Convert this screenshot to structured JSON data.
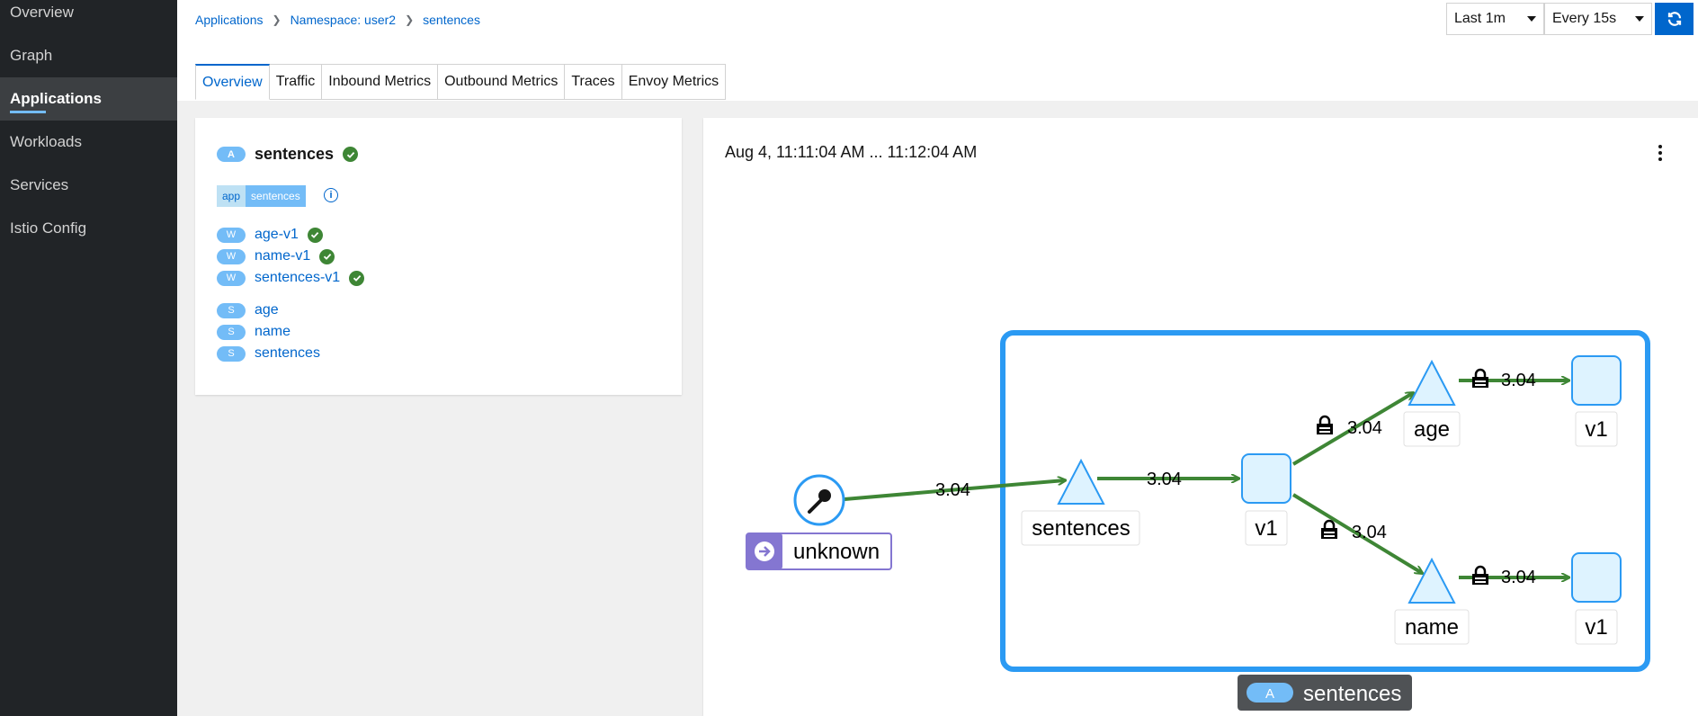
{
  "sidebar": {
    "items": [
      {
        "label": "Overview",
        "active": false
      },
      {
        "label": "Graph",
        "active": false
      },
      {
        "label": "Applications",
        "active": true
      },
      {
        "label": "Workloads",
        "active": false
      },
      {
        "label": "Services",
        "active": false
      },
      {
        "label": "Istio Config",
        "active": false
      }
    ]
  },
  "breadcrumb": {
    "items": [
      "Applications",
      "Namespace: user2",
      "sentences"
    ]
  },
  "toolbar": {
    "duration": "Last 1m",
    "refresh_interval": "Every 15s",
    "refresh_icon": "refresh-icon"
  },
  "tabs": [
    {
      "label": "Overview",
      "active": true
    },
    {
      "label": "Traffic",
      "active": false
    },
    {
      "label": "Inbound Metrics",
      "active": false
    },
    {
      "label": "Outbound Metrics",
      "active": false
    },
    {
      "label": "Traces",
      "active": false
    },
    {
      "label": "Envoy Metrics",
      "active": false
    }
  ],
  "app_info": {
    "badge": "A",
    "name": "sentences",
    "label_key": "app",
    "label_value": "sentences",
    "workloads": [
      {
        "badge": "W",
        "name": "age-v1"
      },
      {
        "badge": "W",
        "name": "name-v1"
      },
      {
        "badge": "W",
        "name": "sentences-v1"
      }
    ],
    "services": [
      {
        "badge": "S",
        "name": "age"
      },
      {
        "badge": "S",
        "name": "name"
      },
      {
        "badge": "S",
        "name": "sentences"
      }
    ]
  },
  "graph": {
    "time_range": "Aug 4, 11:11:04 AM ... 11:12:04 AM",
    "nodes": {
      "unknown": "unknown",
      "sentences_service": "sentences",
      "sentences_v1": "v1",
      "age_service": "age",
      "age_v1": "v1",
      "name_service": "name",
      "name_v1": "v1"
    },
    "edge_rates": {
      "unknown_to_sentences": "3.04",
      "sentences_to_v1": "3.04",
      "v1_to_age": "3.04",
      "age_to_v1": "3.04",
      "v1_to_name": "3.04",
      "name_to_v1": "3.04"
    },
    "app_box": {
      "badge": "A",
      "label": "sentences"
    },
    "colors": {
      "edge": "#3e8635",
      "app_box": "#2b9af3",
      "node_fill": "#def3ff",
      "node_stroke": "#2b9af3",
      "unknown_badge": "#8476d1"
    }
  }
}
